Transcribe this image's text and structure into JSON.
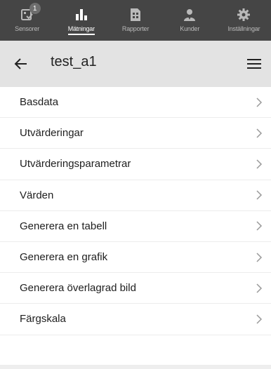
{
  "tabbar": {
    "tabs": [
      {
        "label": "Sensorer",
        "badge": "1",
        "icon": "sensor-icon"
      },
      {
        "label": "Mätningar",
        "icon": "bar-chart-icon"
      },
      {
        "label": "Rapporter",
        "icon": "report-icon"
      },
      {
        "label": "Kunder",
        "icon": "customer-icon"
      },
      {
        "label": "Inställningar",
        "icon": "gear-icon"
      }
    ],
    "active": "Mätningar"
  },
  "header": {
    "title": "test_a1",
    "back_icon": "back-arrow-icon",
    "menu_icon": "hamburger-menu-icon"
  },
  "menu_items": [
    {
      "label": "Basdata"
    },
    {
      "label": "Utvärderingar"
    },
    {
      "label": "Utvärderingsparametrar"
    },
    {
      "label": "Värden"
    },
    {
      "label": "Generera en tabell"
    },
    {
      "label": "Generera en grafik"
    },
    {
      "label": "Generera överlagrad bild"
    },
    {
      "label": "Färgskala"
    }
  ],
  "colors": {
    "tabbar_bg": "#454545",
    "header_bg": "#e3e3e3",
    "text": "#1e1e1e",
    "chevron": "#9a9a9a"
  }
}
